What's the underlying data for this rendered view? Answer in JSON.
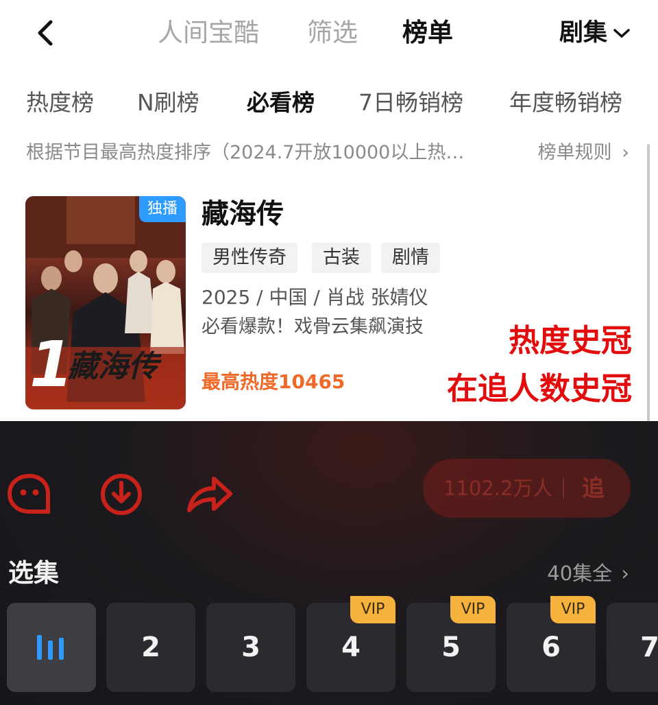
{
  "header": {
    "tabs": [
      {
        "label": "人间宝酷",
        "active": false
      },
      {
        "label": "筛选",
        "active": false
      },
      {
        "label": "榜单",
        "active": true
      }
    ],
    "genre_selector": "剧集"
  },
  "sub_tabs": [
    {
      "label": "热度榜",
      "active": false
    },
    {
      "label": "N刷榜",
      "active": false
    },
    {
      "label": "必看榜",
      "active": true
    },
    {
      "label": "7日畅销榜",
      "active": false
    },
    {
      "label": "年度畅销榜",
      "active": false
    }
  ],
  "ranking_description": "根据节目最高热度排序（2024.7开放10000以上热…",
  "ranking_rules": "榜单规则",
  "show": {
    "rank": "1",
    "badge": "独播",
    "poster_title": "藏海传",
    "title": "藏海传",
    "tags": [
      "男性传奇",
      "古装",
      "剧情"
    ],
    "meta": "2025 / 中国 / 肖战 张婧仪",
    "slogan": "必看爆款！戏骨云集飙演技",
    "peak_heat": "最高热度10465"
  },
  "overlay_text": {
    "line1": "热度史冠",
    "line2": "在追人数史冠"
  },
  "player": {
    "follow_count": "1102.2万人",
    "follow_label": "追",
    "icons": [
      "danmaku-icon",
      "download-icon",
      "share-icon"
    ]
  },
  "episodes": {
    "title": "选集",
    "total": "40集全",
    "list": [
      {
        "label": "",
        "current": true,
        "vip": ""
      },
      {
        "label": "2",
        "current": false,
        "vip": ""
      },
      {
        "label": "3",
        "current": false,
        "vip": ""
      },
      {
        "label": "4",
        "current": false,
        "vip": "VIP"
      },
      {
        "label": "5",
        "current": false,
        "vip": "VIP"
      },
      {
        "label": "6",
        "current": false,
        "vip": "VIP"
      },
      {
        "label": "7",
        "current": false,
        "vip": ""
      }
    ]
  },
  "colors": {
    "accent_orange": "#ef6a28",
    "overlay_red": "#e30c0c",
    "badge_blue": "#2e9bff",
    "vip_gold": "#f5b33d",
    "player_red": "#c8221a"
  }
}
